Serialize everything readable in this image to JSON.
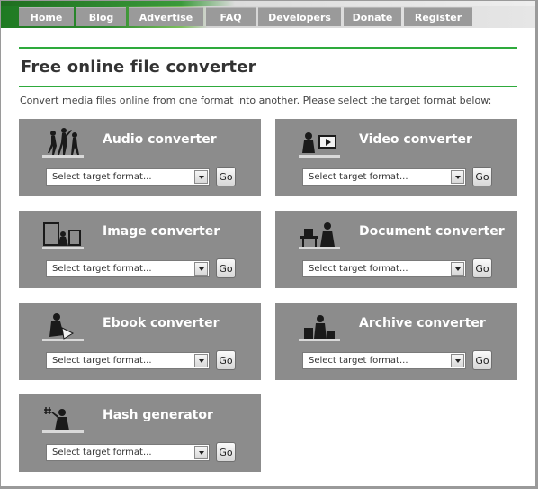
{
  "nav": {
    "tabs": [
      {
        "label": "Home",
        "name": "nav-tab-home"
      },
      {
        "label": "Blog",
        "name": "nav-tab-blog"
      },
      {
        "label": "Advertise",
        "name": "nav-tab-advertise"
      },
      {
        "label": "FAQ",
        "name": "nav-tab-faq"
      },
      {
        "label": "Developers",
        "name": "nav-tab-developers"
      },
      {
        "label": "Donate",
        "name": "nav-tab-donate"
      },
      {
        "label": "Register",
        "name": "nav-tab-register"
      }
    ]
  },
  "main": {
    "title": "Free online file converter",
    "intro": "Convert media files online from one format into another. Please select the target format below:"
  },
  "converters": [
    {
      "title": "Audio converter",
      "icon": "dancers-icon",
      "select_placeholder": "Select target format...",
      "go_label": "Go"
    },
    {
      "title": "Video converter",
      "icon": "tv-viewer-icon",
      "select_placeholder": "Select target format...",
      "go_label": "Go"
    },
    {
      "title": "Image converter",
      "icon": "picture-frames-icon",
      "select_placeholder": "Select target format...",
      "go_label": "Go"
    },
    {
      "title": "Document converter",
      "icon": "desk-worker-icon",
      "select_placeholder": "Select target format...",
      "go_label": "Go"
    },
    {
      "title": "Ebook converter",
      "icon": "reader-icon",
      "select_placeholder": "Select target format...",
      "go_label": "Go"
    },
    {
      "title": "Archive converter",
      "icon": "archive-boxes-icon",
      "select_placeholder": "Select target format...",
      "go_label": "Go"
    },
    {
      "title": "Hash generator",
      "icon": "hash-person-icon",
      "select_placeholder": "Select target format...",
      "go_label": "Go"
    }
  ],
  "colors": {
    "accent_green": "#2eaa3c",
    "card_bg": "#8c8c8c",
    "nav_tab_bg": "#9a9a9a"
  }
}
